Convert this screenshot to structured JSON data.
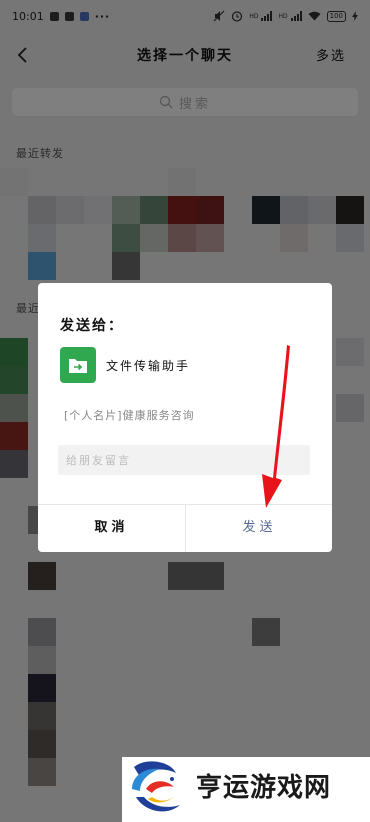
{
  "status_bar": {
    "time": "10:01",
    "dots": "···",
    "net_label_1": "HD",
    "net_label_2": "HD",
    "battery": "100"
  },
  "header": {
    "title": "选择一个聊天",
    "multi_select_label": "多选"
  },
  "search": {
    "placeholder": "搜索"
  },
  "sections": {
    "recent_forward": "最近转发",
    "recent_chats": "最近"
  },
  "dialog": {
    "title": "发送给：",
    "recipient": {
      "name": "文件传输助手",
      "avatar_icon": "folder-transfer-icon",
      "avatar_color": "#2fa84f"
    },
    "message_preview": "[个人名片]健康服务咨询",
    "message_input": {
      "value": "",
      "placeholder": "给朋友留言"
    },
    "cancel_label": "取消",
    "send_label": "发送"
  },
  "annotation": {
    "arrow_color": "#e8141b"
  },
  "watermark": {
    "text": "亨运游戏网"
  },
  "colors": {
    "link_blue": "#576b95",
    "background": "#ededed"
  }
}
